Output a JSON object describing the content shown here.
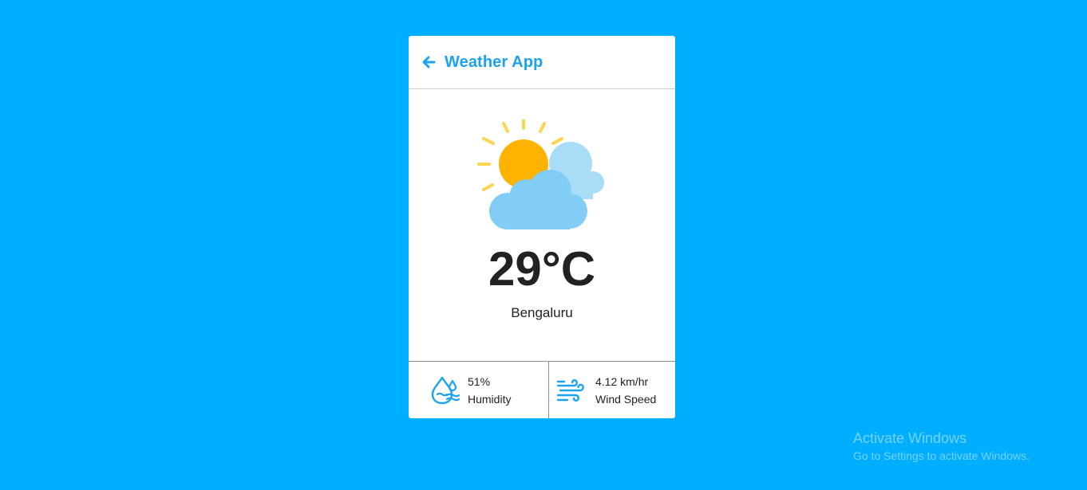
{
  "header": {
    "title": "Weather App",
    "back_icon": "arrow-left-icon"
  },
  "weather": {
    "icon": "partly-cloudy-icon",
    "temperature": "29°C",
    "city": "Bengaluru"
  },
  "stats": {
    "humidity": {
      "icon": "humidity-icon",
      "value": "51%",
      "label": "Humidity"
    },
    "wind": {
      "icon": "wind-icon",
      "value": "4.12 km/hr",
      "label": "Wind Speed"
    }
  },
  "watermark": {
    "title": "Activate Windows",
    "subtitle": "Go to Settings to activate Windows."
  },
  "colors": {
    "background": "#00aeff",
    "accent": "#1ba3ef",
    "sun": "#ffb300",
    "sun_rays": "#ffd54f",
    "cloud_front": "#81cdf5",
    "cloud_back": "#a9dcf6"
  }
}
